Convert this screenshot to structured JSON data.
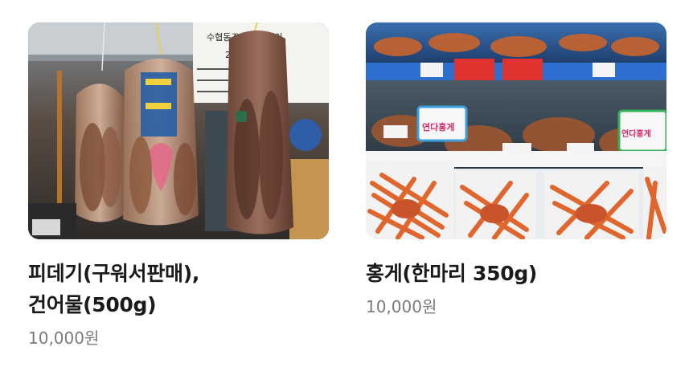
{
  "products": [
    {
      "title_line1": "피데기(구워서판매),",
      "title_line2": "건어물(500g)",
      "price": "10,000원",
      "image": "dried-squid-photo",
      "sign_text": [
        "수협동조합 위판법인",
        "233번"
      ]
    },
    {
      "title_line1": "홍게(한마리 350g)",
      "title_line2": "",
      "price": "10,000원",
      "image": "red-snow-crab-photo",
      "sign_text": [
        "연다홍게",
        "연다홍게"
      ]
    }
  ],
  "colors": {
    "title": "#1a1a1a",
    "price": "#7a7a7a",
    "crab": "#e0662e",
    "tray": "#f4f4f4"
  }
}
